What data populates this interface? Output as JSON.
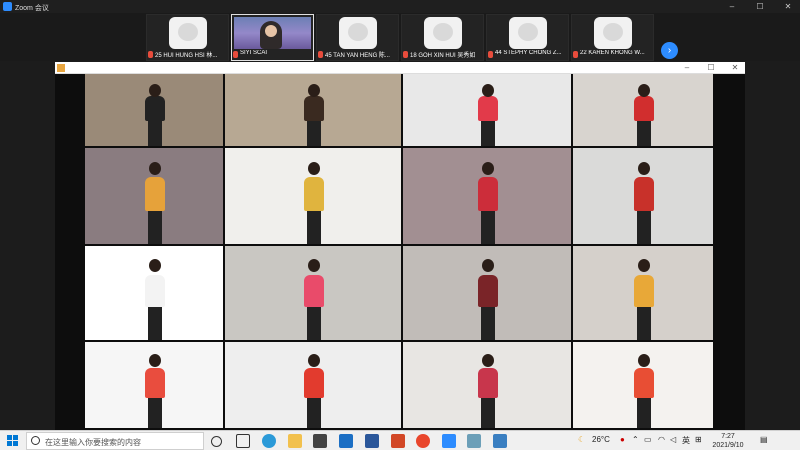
{
  "window": {
    "title": "Zoom 会议",
    "minimize": "–",
    "maximize": "☐",
    "close": "✕"
  },
  "participants": [
    {
      "label": "25 HUI HUNG HSI 林...",
      "kind": "emoji"
    },
    {
      "label": "SIYI SCAI",
      "kind": "video"
    },
    {
      "label": "45 TAN YAN HENG 陈...",
      "kind": "emoji"
    },
    {
      "label": "18 GOH XIN HUI 吴秀如",
      "kind": "emoji"
    },
    {
      "label": "44 STEPHY CHONG Z...",
      "kind": "emoji"
    },
    {
      "label": "22 KAREN KHONG W...",
      "kind": "emoji"
    }
  ],
  "next_arrow": "›",
  "share": {
    "minimize": "–",
    "maximize": "☐",
    "close": "✕"
  },
  "taskbar": {
    "search_placeholder": "在这里输入你要搜索的内容",
    "weather": "26°C",
    "language": "英",
    "time": "7:27",
    "date": "2021/9/10",
    "colors": {
      "accent": "#0078d4",
      "zoom_blue": "#2d8cff"
    }
  }
}
